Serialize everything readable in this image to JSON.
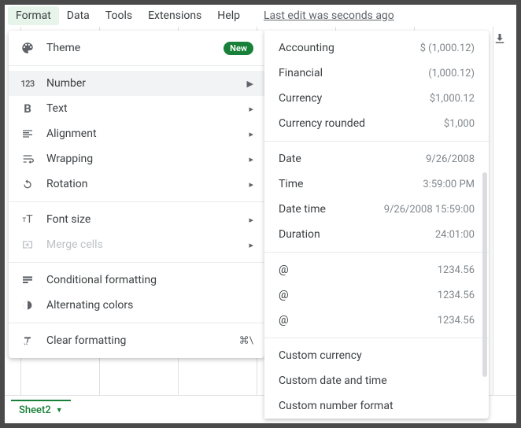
{
  "menubar": {
    "items": [
      "Format",
      "Data",
      "Tools",
      "Extensions",
      "Help"
    ],
    "last_edit": "Last edit was seconds ago"
  },
  "format_menu": {
    "theme": "Theme",
    "theme_badge": "New",
    "number": "Number",
    "text": "Text",
    "alignment": "Alignment",
    "wrapping": "Wrapping",
    "rotation": "Rotation",
    "font_size": "Font size",
    "merge_cells": "Merge cells",
    "conditional": "Conditional formatting",
    "alternating": "Alternating colors",
    "clear": "Clear formatting",
    "clear_shortcut": "⌘\\"
  },
  "number_submenu": {
    "accounting": {
      "label": "Accounting",
      "example": "$ (1,000.12)"
    },
    "financial": {
      "label": "Financial",
      "example": "(1,000.12)"
    },
    "currency": {
      "label": "Currency",
      "example": "$1,000.12"
    },
    "currency_rounded": {
      "label": "Currency rounded",
      "example": "$1,000"
    },
    "date": {
      "label": "Date",
      "example": "9/26/2008"
    },
    "time": {
      "label": "Time",
      "example": "3:59:00 PM"
    },
    "date_time": {
      "label": "Date time",
      "example": "9/26/2008 15:59:00"
    },
    "duration": {
      "label": "Duration",
      "example": "24:01:00"
    },
    "at1": {
      "label": "@",
      "example": "1234.56"
    },
    "at2": {
      "label": "@",
      "example": "1234.56"
    },
    "at3": {
      "label": "@",
      "example": "1234.56"
    },
    "custom_currency": "Custom currency",
    "custom_datetime": "Custom date and time",
    "custom_number": "Custom number format"
  },
  "sheet": {
    "tab": "Sheet2"
  }
}
